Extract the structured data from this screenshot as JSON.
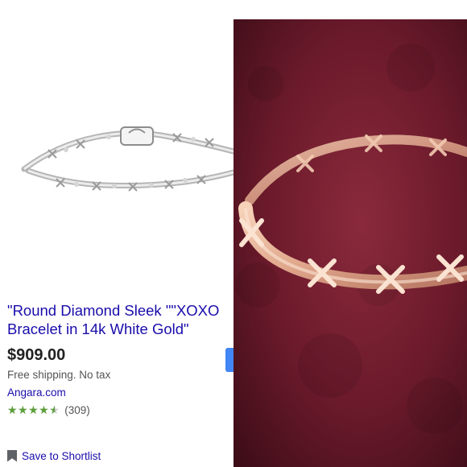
{
  "product": {
    "title_line1": "\"Round Diamond Sleek \"\"XOXO",
    "title_line2": "Bracelet in 14k White Gold\"",
    "price": "$909.00",
    "shipping": "Free shipping. No tax",
    "merchant": "Angara.com",
    "rating": 4.5,
    "rating_max": 5,
    "review_count": "(309)",
    "stars_glyphs": "★★★★★"
  },
  "actions": {
    "save_label": "Save to Shortlist"
  },
  "colors": {
    "link": "#1a0dab",
    "star": "#5d9f3a",
    "buy_button": "#4285f4",
    "photo_background": "#6b1a2b"
  },
  "icons": [
    "bookmark-icon",
    "star-icon"
  ],
  "images": {
    "left": "white gold XOXO diamond bracelet product photo",
    "right": "gold XOXO bracelet on burgundy fabric"
  }
}
